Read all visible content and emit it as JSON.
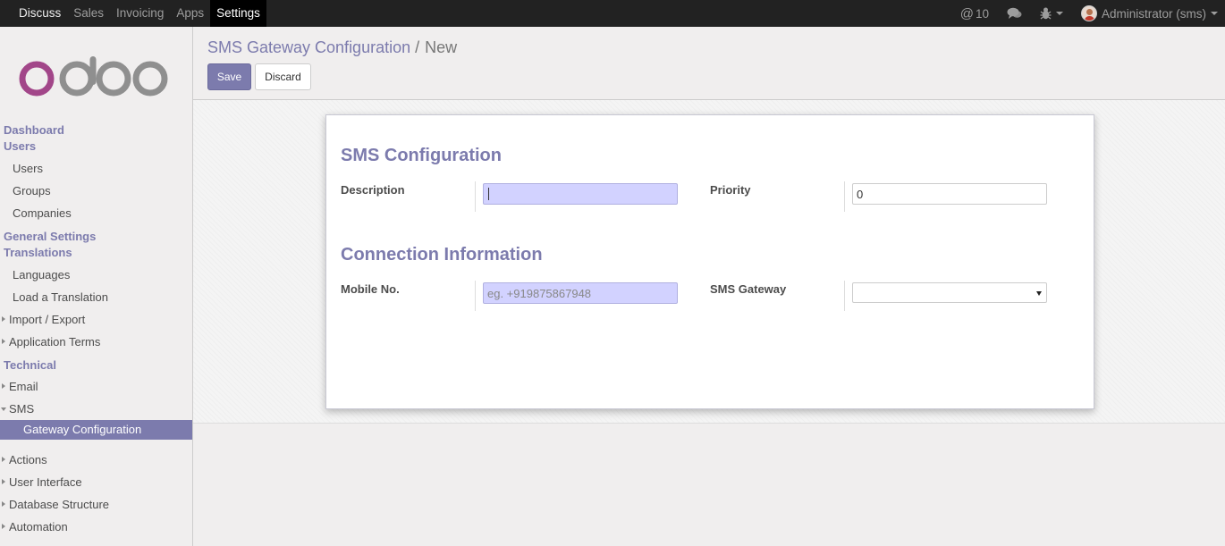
{
  "topbar": {
    "apps": [
      "Discuss",
      "Sales",
      "Invoicing",
      "Apps",
      "Settings"
    ],
    "active_app": "Settings",
    "mentions_icon": "@",
    "mentions_count": "10",
    "chat_icon": "chat-bubbles-icon",
    "debug_icon": "bug-icon",
    "user_label": "Administrator (sms)"
  },
  "sidebar": {
    "logo_text": "odoo",
    "logo_colors": {
      "o": "#a24689",
      "doo": "#8f8f8f"
    },
    "dashboard": "Dashboard",
    "users_header": "Users",
    "users_items": [
      "Users",
      "Groups",
      "Companies"
    ],
    "general_settings": "General Settings",
    "translations_header": "Translations",
    "translations_items": [
      "Languages",
      "Load a Translation"
    ],
    "translations_parents": [
      "Import / Export",
      "Application Terms"
    ],
    "technical_header": "Technical",
    "technical_email": "Email",
    "technical_sms": "SMS",
    "active_item": "Gateway Configuration",
    "technical_parents": [
      "Actions",
      "User Interface",
      "Database Structure",
      "Automation"
    ]
  },
  "control_panel": {
    "breadcrumb_parent": "SMS Gateway Configuration",
    "breadcrumb_separator": "/",
    "breadcrumb_current": "New",
    "save_label": "Save",
    "discard_label": "Discard"
  },
  "form": {
    "section1_title": "SMS Configuration",
    "description_label": "Description",
    "description_value": "",
    "priority_label": "Priority",
    "priority_value": "0",
    "section2_title": "Connection Information",
    "mobile_label": "Mobile No.",
    "mobile_placeholder": "eg. +919875867948",
    "gateway_label": "SMS Gateway",
    "gateway_value": ""
  },
  "colors": {
    "accent": "#7c7bad",
    "navbar": "#222222",
    "required_field": "#d2d2ff"
  }
}
